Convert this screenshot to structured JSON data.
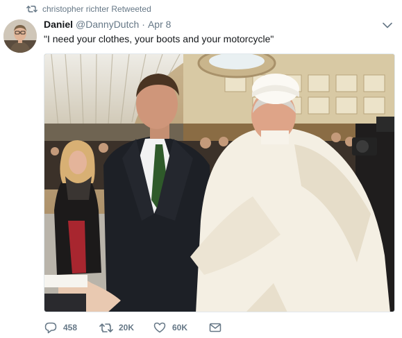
{
  "retweet_context": {
    "text": "christopher richter Retweeted"
  },
  "tweet": {
    "author_name": "Daniel",
    "author_handle": "@DannyDutch",
    "separator": "·",
    "date": "Apr 8",
    "text": "\"I need your clothes, your boots and your motorcycle\""
  },
  "actions": {
    "replies": "458",
    "retweets": "20K",
    "likes": "60K"
  },
  "colors": {
    "secondary_text": "#657786",
    "primary_text": "#14171a",
    "border": "#e1e8ed"
  },
  "icons": {
    "retweet_context": "retweet-icon",
    "menu": "chevron-down-icon",
    "reply": "reply-icon",
    "retweet": "retweet-icon",
    "like": "heart-icon",
    "dm": "envelope-icon"
  }
}
